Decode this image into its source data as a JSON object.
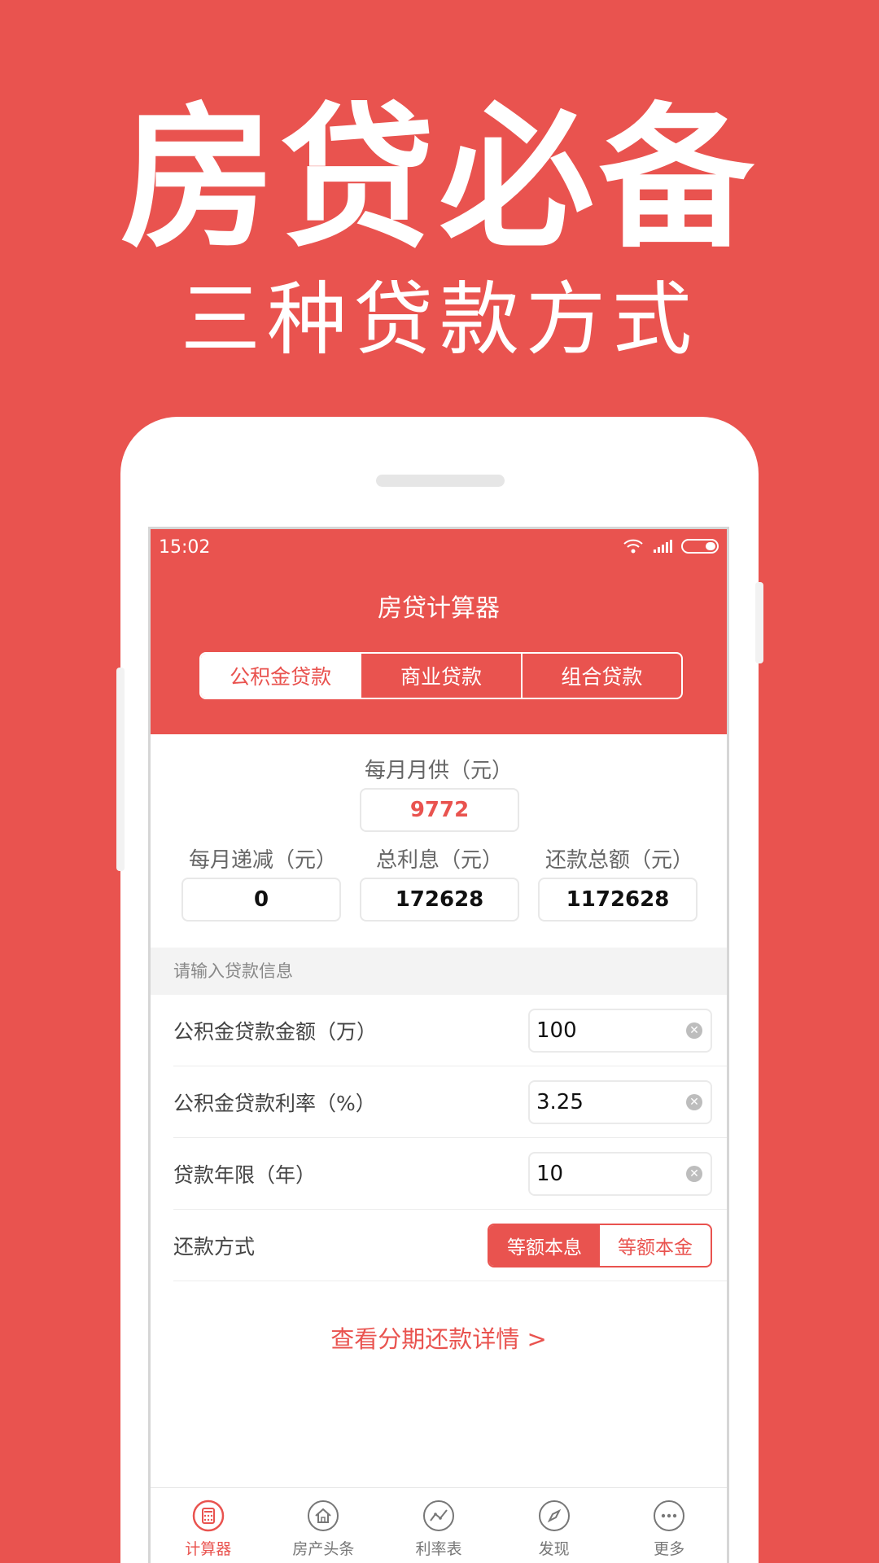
{
  "promo": {
    "title": "房贷必备",
    "subtitle": "三种贷款方式"
  },
  "status_bar": {
    "time": "15:02"
  },
  "app": {
    "title": "房贷计算器"
  },
  "tabs": [
    {
      "label": "公积金贷款",
      "active": true
    },
    {
      "label": "商业贷款",
      "active": false
    },
    {
      "label": "组合贷款",
      "active": false
    }
  ],
  "results": {
    "monthly_payment": {
      "label": "每月月供（元）",
      "value": "9772"
    },
    "monthly_decrease": {
      "label": "每月递减（元）",
      "value": "0"
    },
    "total_interest": {
      "label": "总利息（元）",
      "value": "172628"
    },
    "total_repayment": {
      "label": "还款总额（元）",
      "value": "1172628"
    }
  },
  "form": {
    "section_title": "请输入贷款信息",
    "loan_amount": {
      "label": "公积金贷款金额（万）",
      "value": "100"
    },
    "loan_rate": {
      "label": "公积金贷款利率（%）",
      "value": "3.25"
    },
    "loan_term": {
      "label": "贷款年限（年）",
      "value": "10"
    },
    "repay_method": {
      "label": "还款方式",
      "options": [
        "等额本息",
        "等额本金"
      ],
      "selected": "等额本息"
    }
  },
  "details_link": "查看分期还款详情 >",
  "bottom_nav": [
    {
      "label": "计算器",
      "icon": "calculator-icon",
      "active": true
    },
    {
      "label": "房产头条",
      "icon": "house-icon",
      "active": false
    },
    {
      "label": "利率表",
      "icon": "trend-chart-icon",
      "active": false
    },
    {
      "label": "发现",
      "icon": "compass-icon",
      "active": false
    },
    {
      "label": "更多",
      "icon": "more-dots-icon",
      "active": false
    }
  ],
  "colors": {
    "brand": "#E9534F",
    "white": "#FFFFFF"
  }
}
